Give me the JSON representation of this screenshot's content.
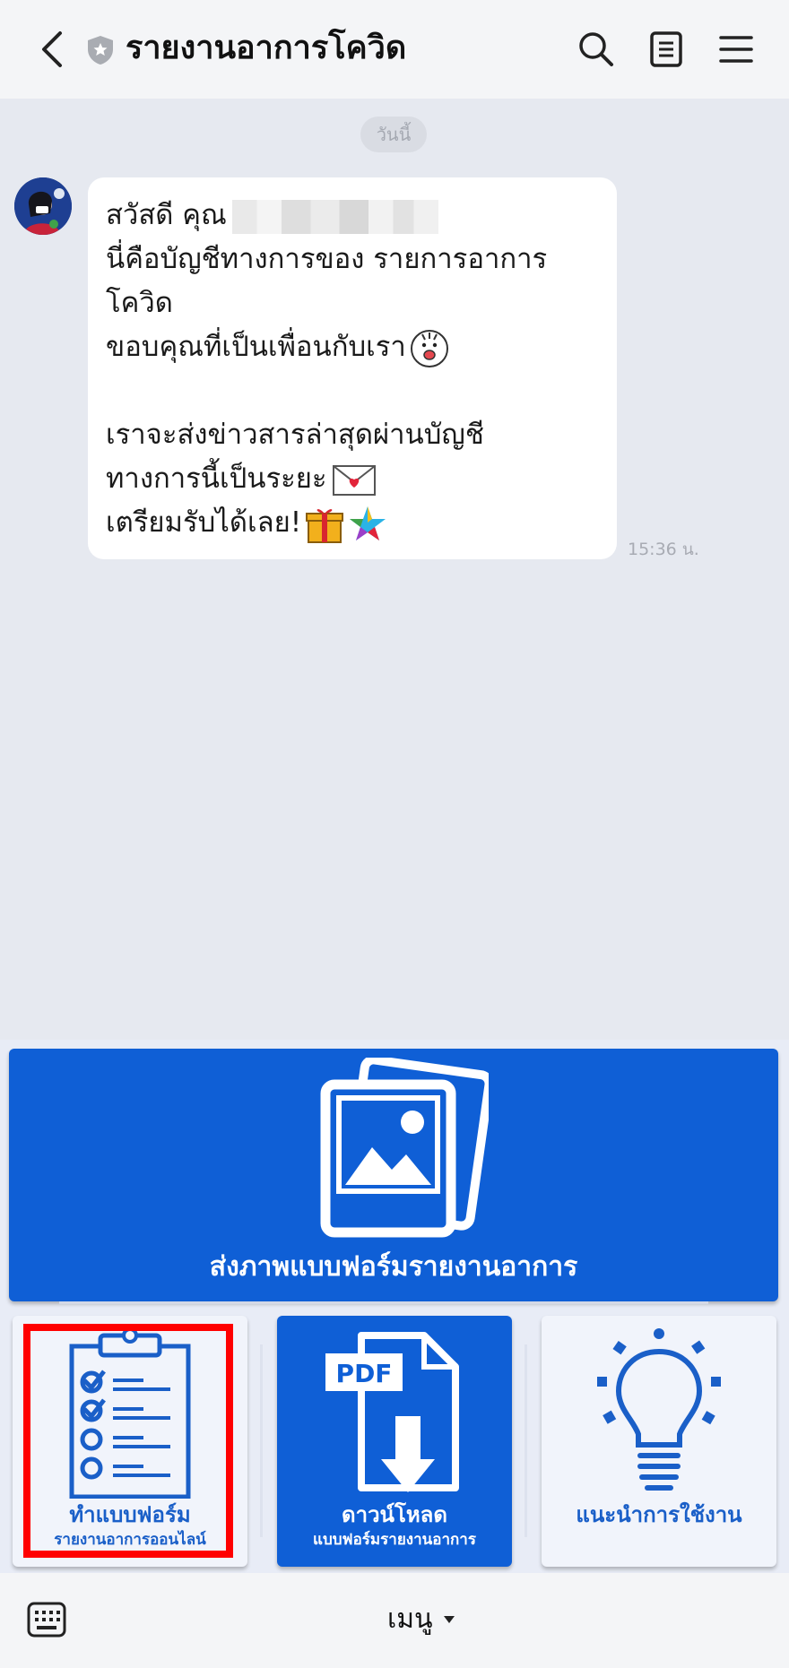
{
  "header": {
    "title": "รายงานอาการโควิด",
    "back_icon": "chevron-left-icon",
    "shield_icon": "shield-star-icon",
    "search_icon": "search-icon",
    "notes_icon": "notes-icon",
    "menu_icon": "hamburger-icon"
  },
  "chat": {
    "date_label": "วันนี้",
    "message": {
      "greeting": "สวัสดี คุณ",
      "line2": "นี่คือบัญชีทางการของ รายการอาการ",
      "line3": "โควิด",
      "line4": "ขอบคุณที่เป็นเพื่อนกับเรา",
      "line6": "เราจะส่งข่าวสารล่าสุดผ่านบัญชี",
      "line7": "ทางการนี้เป็นระยะ",
      "line8": "เตรียมรับได้เลย!",
      "time": "15:36 น."
    }
  },
  "rich_menu": {
    "banner_label": "ส่งภาพแบบฟอร์มรายงานอาการ",
    "cards": [
      {
        "title": "ทำแบบฟอร์ม",
        "subtitle": "รายงานอาการออนไลน์"
      },
      {
        "title": "ดาวน์โหลด",
        "subtitle": "แบบฟอร์มรายงานอาการ",
        "badge": "PDF"
      },
      {
        "title": "แนะนำการใช้งาน"
      }
    ]
  },
  "bottom_bar": {
    "menu_label": "เมนู"
  },
  "colors": {
    "accent_blue": "#0f5fd6",
    "highlight_red": "#ff0000",
    "chat_bg": "#e6e9f0"
  }
}
